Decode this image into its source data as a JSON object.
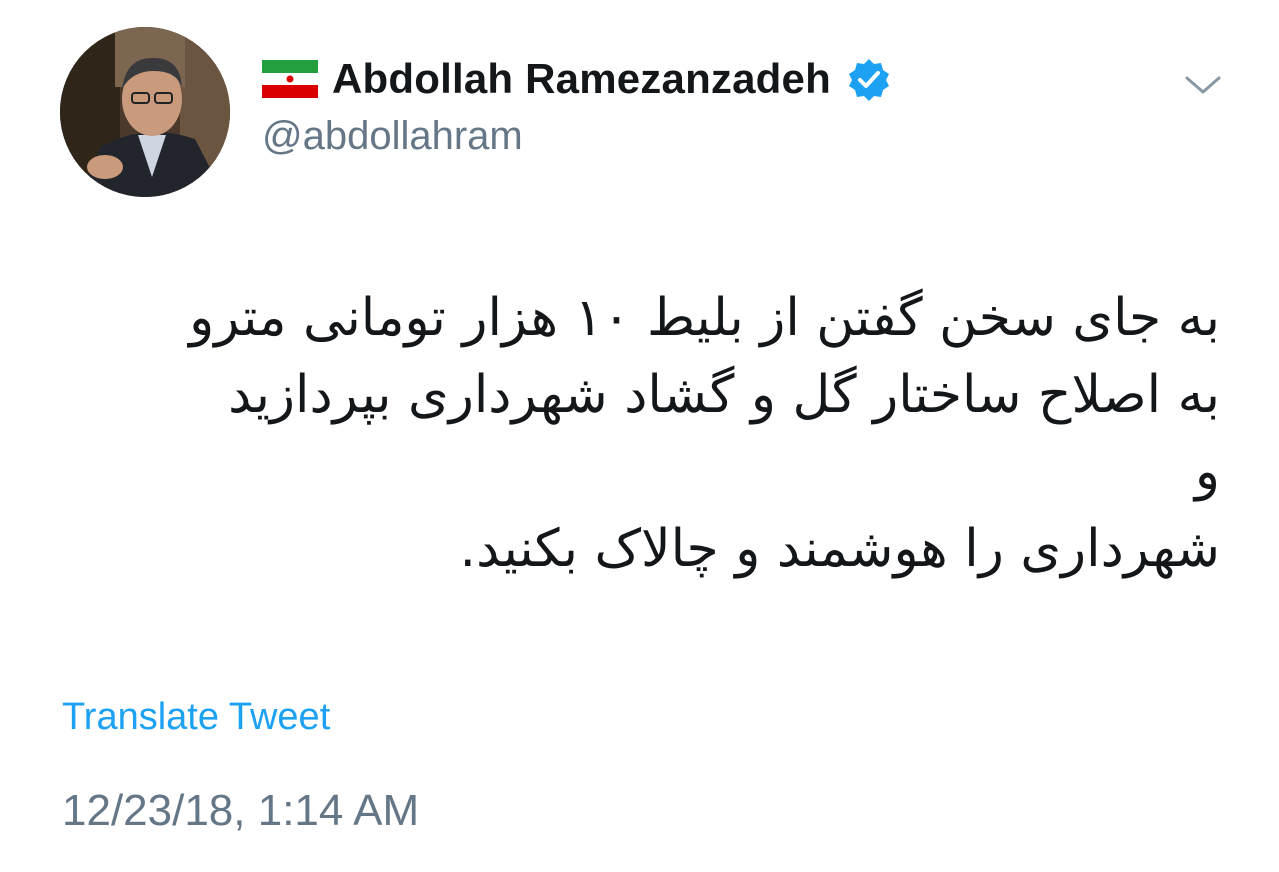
{
  "user": {
    "display_name": "Abdollah Ramezanzadeh",
    "handle": "@abdollahram",
    "flag_icon": "iran-flag-icon",
    "verified_icon": "verified-badge-icon",
    "avatar_icon": "profile-photo"
  },
  "tweet": {
    "lines": [
      "به جای سخن گفتن از بلیط ۱۰ هزار تومانی مترو",
      "به اصلاح ساختار گل و گشاد شهرداری بپردازید",
      "و",
      "شهرداری را هوشمند و چالاک بکنید."
    ],
    "translate_label": "Translate Tweet",
    "timestamp": "12/23/18, 1:14 AM"
  },
  "menu": {
    "caret_icon": "chevron-down-icon"
  },
  "colors": {
    "link": "#1da1f2",
    "muted": "#657786",
    "text": "#14171a",
    "verified": "#1da1f2"
  }
}
